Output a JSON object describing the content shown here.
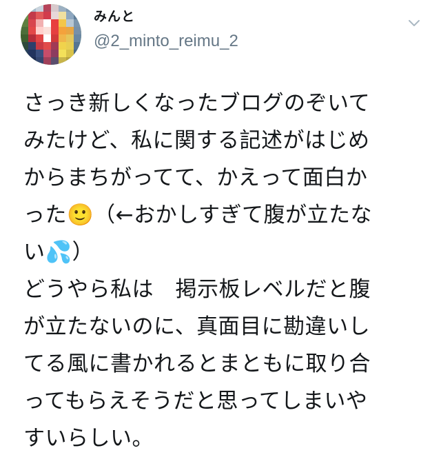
{
  "tweet": {
    "author": {
      "display_name": "みんと",
      "username": "@2_minto_reimu_2"
    },
    "menu_icon": "chevron-down-icon",
    "text": "さっき新しくなったブログのぞいて\nみたけど、私に関する記述がはじめ\nからまちがってて、かえって面白か\nった🙂（←おかしすぎて腹が立たな\nい💦）\nどうやら私は　掲示板レベルだと腹\nが立たないのに、真面目に勘違いし\nてる風に書かれるとまともに取り合\nってもらえそうだと思ってしまいや\nすいらしい。"
  }
}
